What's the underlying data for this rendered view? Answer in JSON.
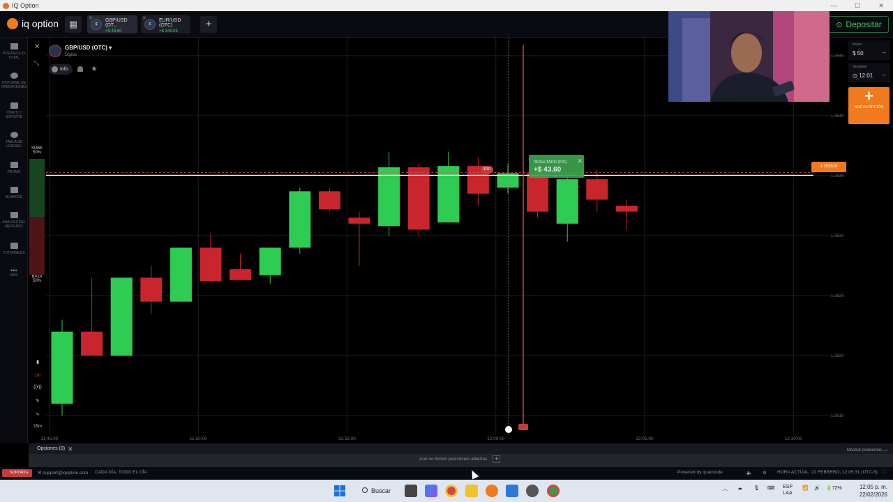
{
  "window": {
    "title": "IQ Option"
  },
  "topbar": {
    "logo": "iq option",
    "tabs": [
      {
        "pair": "GBP/USD (OT...",
        "pnl": "+$ 43.60"
      },
      {
        "pair": "EUR/USD (OTC)",
        "pnl": "+$ 348.85"
      }
    ],
    "deposit_label": "Depositar"
  },
  "sidebar": {
    "items": [
      {
        "label": "PORTAFOLIO TOTAL",
        "icon": "briefcase-icon"
      },
      {
        "label": "HISTORIAL DE OPERACIONES",
        "icon": "history-icon"
      },
      {
        "label": "CHATS Y SOPORTE",
        "icon": "chat-icon"
      },
      {
        "label": "TABLA DE LÍDERES",
        "icon": "leaderboard-icon"
      },
      {
        "label": "PROMO",
        "icon": "promo-icon"
      },
      {
        "label": "ALMACÉN",
        "icon": "store-icon"
      },
      {
        "label": "ANÁLISIS DEL MERCADO",
        "icon": "analysis-icon"
      },
      {
        "label": "TUTORIALES",
        "icon": "tutorials-icon"
      },
      {
        "label": "MÁS",
        "icon": "more-icon"
      }
    ]
  },
  "asset": {
    "name": "GBP/USD (OTC)",
    "type": "Digital",
    "info_label": "Info"
  },
  "sentiment": {
    "up_label": "SUBE",
    "up_pct": "50%",
    "down_label": "BAJA",
    "down_pct": "50%"
  },
  "timeframe": {
    "candle": "1m",
    "range": "15m"
  },
  "right_panel": {
    "investment_label": "Invers",
    "investment_value": "$ 50",
    "expiry_label": "Vencimie",
    "expiry_value": "12:01",
    "new_option_label": "NUEVA OPCIÓN"
  },
  "result": {
    "label": "RESULTADO (P/G)",
    "value": "+$ 43.60"
  },
  "stake_tag": "$ 50",
  "current_price": "1.353515",
  "chart_data": {
    "type": "candlestick",
    "instrument": "GBP/USD (OTC)",
    "timeframe": "1m",
    "ylim": [
      1.35135,
      1.35465
    ],
    "y_ticks": [
      "1.3545",
      "1.3540",
      "1.3535",
      "1.3530",
      "1.3525",
      "1.3520",
      "1.3515"
    ],
    "x_ticks": [
      "11:45:00",
      "11:50:00",
      "11:55:00",
      "12:00:00",
      "12:05:00",
      "12:10:00"
    ],
    "candles": [
      {
        "o": 1.3516,
        "h": 1.3523,
        "l": 1.3515,
        "c": 1.3522
      },
      {
        "o": 1.3522,
        "h": 1.35265,
        "l": 1.352,
        "c": 1.352
      },
      {
        "o": 1.352,
        "h": 1.35265,
        "l": 1.352,
        "c": 1.35265
      },
      {
        "o": 1.35265,
        "h": 1.35275,
        "l": 1.35235,
        "c": 1.35245
      },
      {
        "o": 1.35245,
        "h": 1.3529,
        "l": 1.35245,
        "c": 1.3529
      },
      {
        "o": 1.3529,
        "h": 1.35302,
        "l": 1.35265,
        "c": 1.35262
      },
      {
        "o": 1.35272,
        "h": 1.35285,
        "l": 1.35265,
        "c": 1.35263
      },
      {
        "o": 1.35267,
        "h": 1.3529,
        "l": 1.3526,
        "c": 1.3529
      },
      {
        "o": 1.3529,
        "h": 1.3534,
        "l": 1.35285,
        "c": 1.35337
      },
      {
        "o": 1.35337,
        "h": 1.3534,
        "l": 1.3532,
        "c": 1.35322
      },
      {
        "o": 1.35315,
        "h": 1.3532,
        "l": 1.35275,
        "c": 1.3531
      },
      {
        "o": 1.35308,
        "h": 1.3537,
        "l": 1.353,
        "c": 1.35357
      },
      {
        "o": 1.35357,
        "h": 1.3536,
        "l": 1.353,
        "c": 1.35305
      },
      {
        "o": 1.35311,
        "h": 1.3537,
        "l": 1.35311,
        "c": 1.35358
      },
      {
        "o": 1.35358,
        "h": 1.35365,
        "l": 1.35325,
        "c": 1.35335
      },
      {
        "o": 1.3534,
        "h": 1.3536,
        "l": 1.35335,
        "c": 1.35352
      },
      {
        "o": 1.35352,
        "h": 1.35357,
        "l": 1.35315,
        "c": 1.3532
      },
      {
        "o": 1.3531,
        "h": 1.3535,
        "l": 1.35295,
        "c": 1.35347
      },
      {
        "o": 1.35347,
        "h": 1.35355,
        "l": 1.3532,
        "c": 1.3533
      },
      {
        "o": 1.35325,
        "h": 1.3533,
        "l": 1.35305,
        "c": 1.3532
      }
    ],
    "current_price": 1.353515,
    "entry_price": 1.35352
  },
  "bottom": {
    "options_tab": "Opciones (0)",
    "no_positions": "Aún no tienes posiciones abiertas",
    "show_positions": "Mostrar posiciones"
  },
  "status": {
    "support": "SOPORTE",
    "email": "support@iqoption.com",
    "hours": "CADA DÍA, TODO EL DÍA",
    "powered": "Powered by quadcode",
    "time": "HORA ACTUAL: 22 FEBRERO, 12:05:31 (UTC-5)"
  },
  "taskbar": {
    "search": "Buscar",
    "lang1": "ESP",
    "lang2": "LAA",
    "battery": "72%",
    "time": "12:05 p. m.",
    "date": "22/02/2026"
  },
  "colors": {
    "up": "#2ecc52",
    "down": "#c9252c",
    "accent": "#f07a1d"
  }
}
